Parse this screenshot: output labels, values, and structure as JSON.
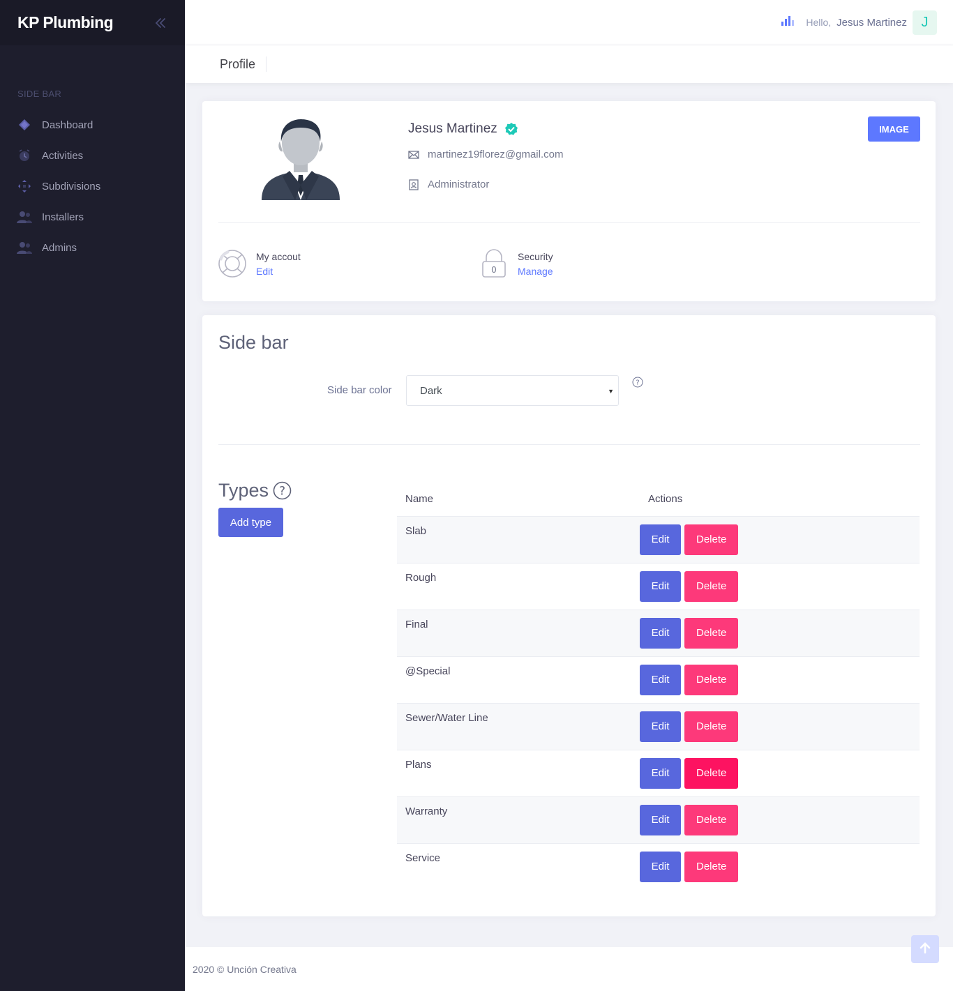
{
  "app": {
    "brand": "KP Plumbing"
  },
  "sidebar": {
    "section_label": "SIDE BAR",
    "items": [
      {
        "label": "Dashboard",
        "icon": "diamond-icon"
      },
      {
        "label": "Activities",
        "icon": "clock-icon"
      },
      {
        "label": "Subdivisions",
        "icon": "arrows-icon"
      },
      {
        "label": "Installers",
        "icon": "users-icon"
      },
      {
        "label": "Admins",
        "icon": "users-icon"
      }
    ]
  },
  "topbar": {
    "greeting": "Hello,",
    "user_name": "Jesus Martinez",
    "avatar_letter": "J"
  },
  "subheader": {
    "title": "Profile"
  },
  "profile": {
    "name": "Jesus Martinez",
    "email": "martinez19florez@gmail.com",
    "role": "Administrator",
    "image_button": "IMAGE",
    "account": {
      "title": "My accout",
      "link": "Edit"
    },
    "security": {
      "title": "Security",
      "link": "Manage"
    }
  },
  "settings": {
    "sidebar_title": "Side bar",
    "sidebar_color_label": "Side bar color",
    "sidebar_color_value": "Dark",
    "types_title": "Types",
    "add_type_button": "Add type",
    "table": {
      "headers": [
        "Name",
        "Actions"
      ],
      "rows": [
        "Slab",
        "Rough",
        "Final",
        "@Special",
        "Sewer/Water Line",
        "Plans",
        "Warranty",
        "Service"
      ],
      "edit_label": "Edit",
      "delete_label": "Delete"
    }
  },
  "footer": {
    "text": "2020 © Unción Creativa"
  },
  "colors": {
    "primary": "#5867dd",
    "danger": "#fd397a",
    "sidebar_bg": "#1e1e2d",
    "accent": "#5d78ff"
  }
}
